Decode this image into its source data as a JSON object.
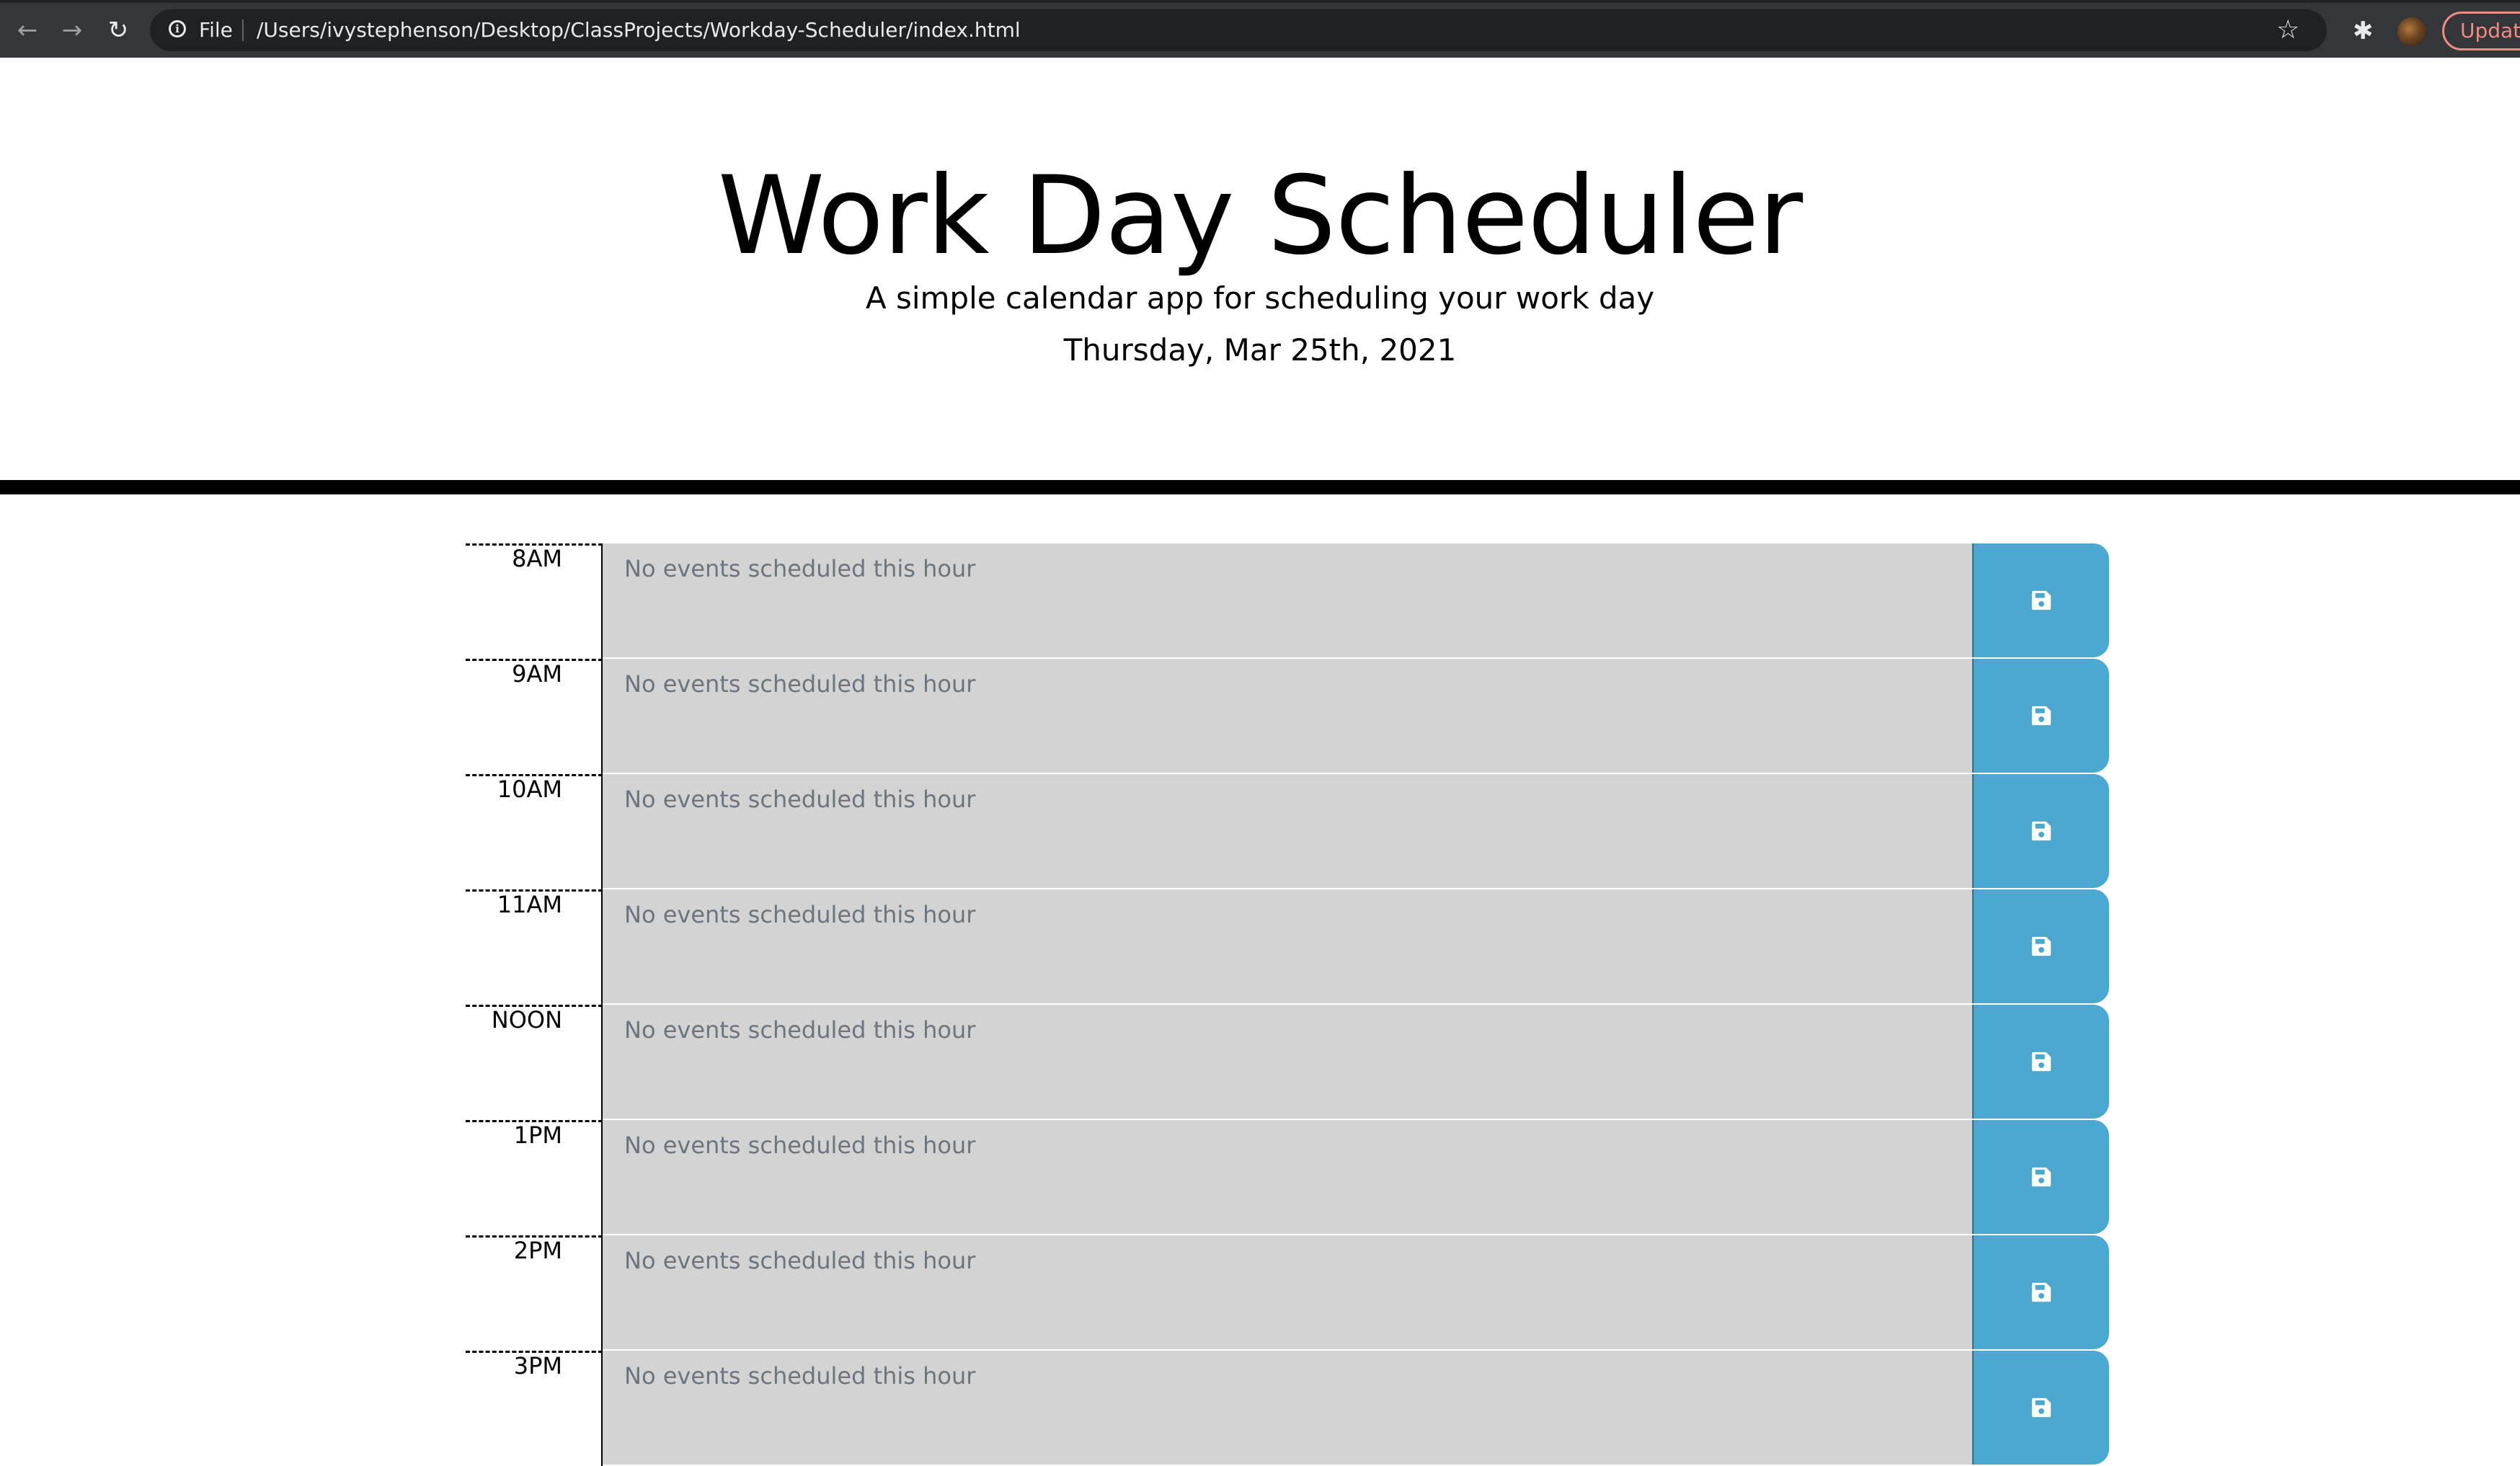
{
  "browser": {
    "back_glyph": "←",
    "forward_glyph": "→",
    "reload_glyph": "↻",
    "info_glyph": "i",
    "scheme_label": "File",
    "url": "/Users/ivystephenson/Desktop/ClassProjects/Workday-Scheduler/index.html",
    "star_glyph": "☆",
    "extensions_glyph": "✱",
    "update_label": "Update",
    "icons": [
      "back-arrow-icon",
      "forward-arrow-icon",
      "reload-icon",
      "info-icon",
      "bookmark-star-icon",
      "extensions-puzzle-icon",
      "profile-avatar"
    ]
  },
  "header": {
    "title": "Work Day Scheduler",
    "lead": "A simple calendar app for scheduling your work day",
    "current_day": "Thursday, Mar 25th, 2021"
  },
  "schedule": {
    "placeholder": "No events scheduled this hour",
    "save_icon": "floppy-disk-save-icon",
    "colors": {
      "past": "#d3d3d3",
      "save_button": "#4ba8d0",
      "placeholder_text": "#6c757d"
    },
    "hours": [
      {
        "label": "8AM"
      },
      {
        "label": "9AM"
      },
      {
        "label": "10AM"
      },
      {
        "label": "11AM"
      },
      {
        "label": "NOON"
      },
      {
        "label": "1PM"
      },
      {
        "label": "2PM"
      },
      {
        "label": "3PM"
      }
    ]
  }
}
